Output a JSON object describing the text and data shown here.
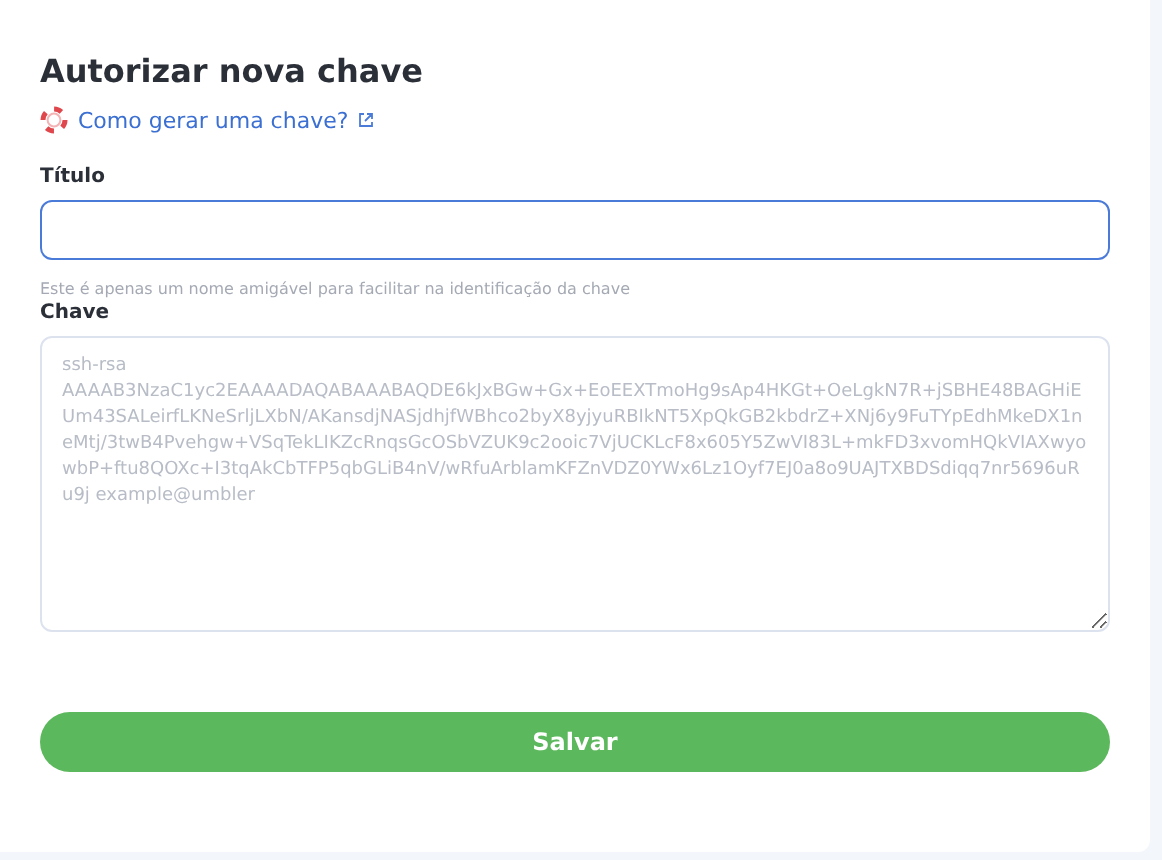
{
  "title": "Autorizar nova chave",
  "help_link": {
    "label": "Como gerar uma chave?"
  },
  "fields": [
    {
      "label": "Título",
      "hint": "Este é apenas um nome amigável para facilitar na identificação da chave"
    },
    {
      "label": "Chave",
      "placeholder": "ssh-rsa\nAAAAB3NzaC1yc2EAAAADAQABAAABAQDE6kJxBGw+Gx+EoEEXTmoHg9sAp4HKGt+OeLgkN7R+jSBHE48BAGHiEUm43SALeirfLKNeSrljLXbN/AKansdjNASjdhjfWBhco2byX8yjyuRBIkNT5XpQkGB2kbdrZ+XNj6y9FuTYpEdhMkeDX1neMtj/3twB4Pvehgw+VSqTekLIKZcRnqsGcOSbVZUK9c2ooic7VjUCKLcF8x605Y5ZwVI83L+mkFD3xvomHQkVIAXwyowbP+ftu8QOXc+I3tqAkCbTFP5qbGLiB4nV/wRfuArblamKFZnVDZ0YWx6Lz1Oyf7EJ0a8o9UAJTXBDSdiqq7nr5696uRu9j example@umbler"
    }
  ],
  "button": "Salvar"
}
